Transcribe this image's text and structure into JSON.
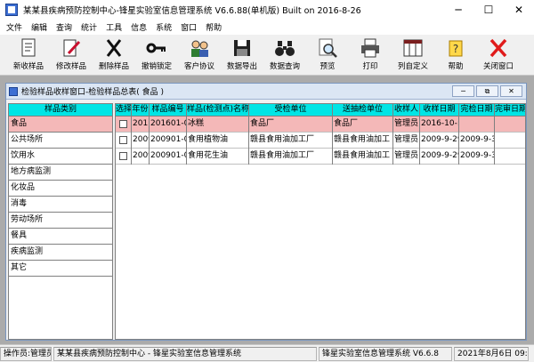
{
  "window": {
    "title": "某某县疾病预防控制中心-锋星实验室信息管理系统 V6.6.88(单机版) Built on 2016-8-26",
    "minimize": "─",
    "maximize": "☐",
    "close": "✕"
  },
  "menu": [
    "文件",
    "编辑",
    "查询",
    "统计",
    "工具",
    "信息",
    "系统",
    "窗口",
    "帮助"
  ],
  "toolbar": [
    {
      "label": "新收样品",
      "icon": "new-sample-icon"
    },
    {
      "label": "修改样品",
      "icon": "edit-sample-icon"
    },
    {
      "label": "删除样品",
      "icon": "delete-sample-icon"
    },
    {
      "label": "撤销锁定",
      "icon": "key-icon"
    },
    {
      "label": "客户协议",
      "icon": "client-agreement-icon"
    },
    {
      "label": "数据导出",
      "icon": "export-icon"
    },
    {
      "label": "数据查询",
      "icon": "binoculars-icon"
    },
    {
      "label": "预览",
      "icon": "preview-icon"
    },
    {
      "label": "打印",
      "icon": "printer-icon"
    },
    {
      "label": "列自定义",
      "icon": "columns-icon"
    },
    {
      "label": "帮助",
      "icon": "help-icon"
    },
    {
      "label": "关闭窗口",
      "icon": "close-window-icon"
    }
  ],
  "child_window": {
    "title": "检验样品收样窗口-检验样品总表( 食品 )",
    "min": "─",
    "restore": "⧉",
    "close": "✕"
  },
  "categories": {
    "header": "样品类别",
    "items": [
      "食品",
      "公共场所",
      "饮用水",
      "地方病监测",
      "化妆品",
      "消毒",
      "劳动场所",
      "餐具",
      "疾病监测",
      "其它"
    ],
    "selected": 0
  },
  "grid": {
    "columns": [
      "选择",
      "年份",
      "样品编号",
      "样品(检测点)名称",
      "受检单位",
      "送抽检单位",
      "收样人",
      "收样日期",
      "完检日期",
      "完审日期"
    ],
    "rows": [
      [
        "",
        "201",
        "201601-0",
        "冰糕",
        "食品厂",
        "食品厂",
        "管理员",
        "2016-10-:",
        "",
        ""
      ],
      [
        "",
        "2009",
        "200901-0",
        "食用植物油",
        "赣县食用油加工厂",
        "赣县食用油加工",
        "管理员",
        "2009-9-29",
        "2009-9-3",
        ""
      ],
      [
        "",
        "2009",
        "200901-0",
        "食用花生油",
        "赣县食用油加工厂",
        "赣县食用油加工",
        "管理员",
        "2009-9-29",
        "2009-9-3",
        ""
      ]
    ]
  },
  "status": {
    "operator": "操作员:管理员",
    "org": "某某县疾病预防控制中心 - 锋星实验室信息管理系统",
    "system": "锋星实验室信息管理系统 V6.6.8",
    "datetime": "2021年8月6日 09:20"
  }
}
